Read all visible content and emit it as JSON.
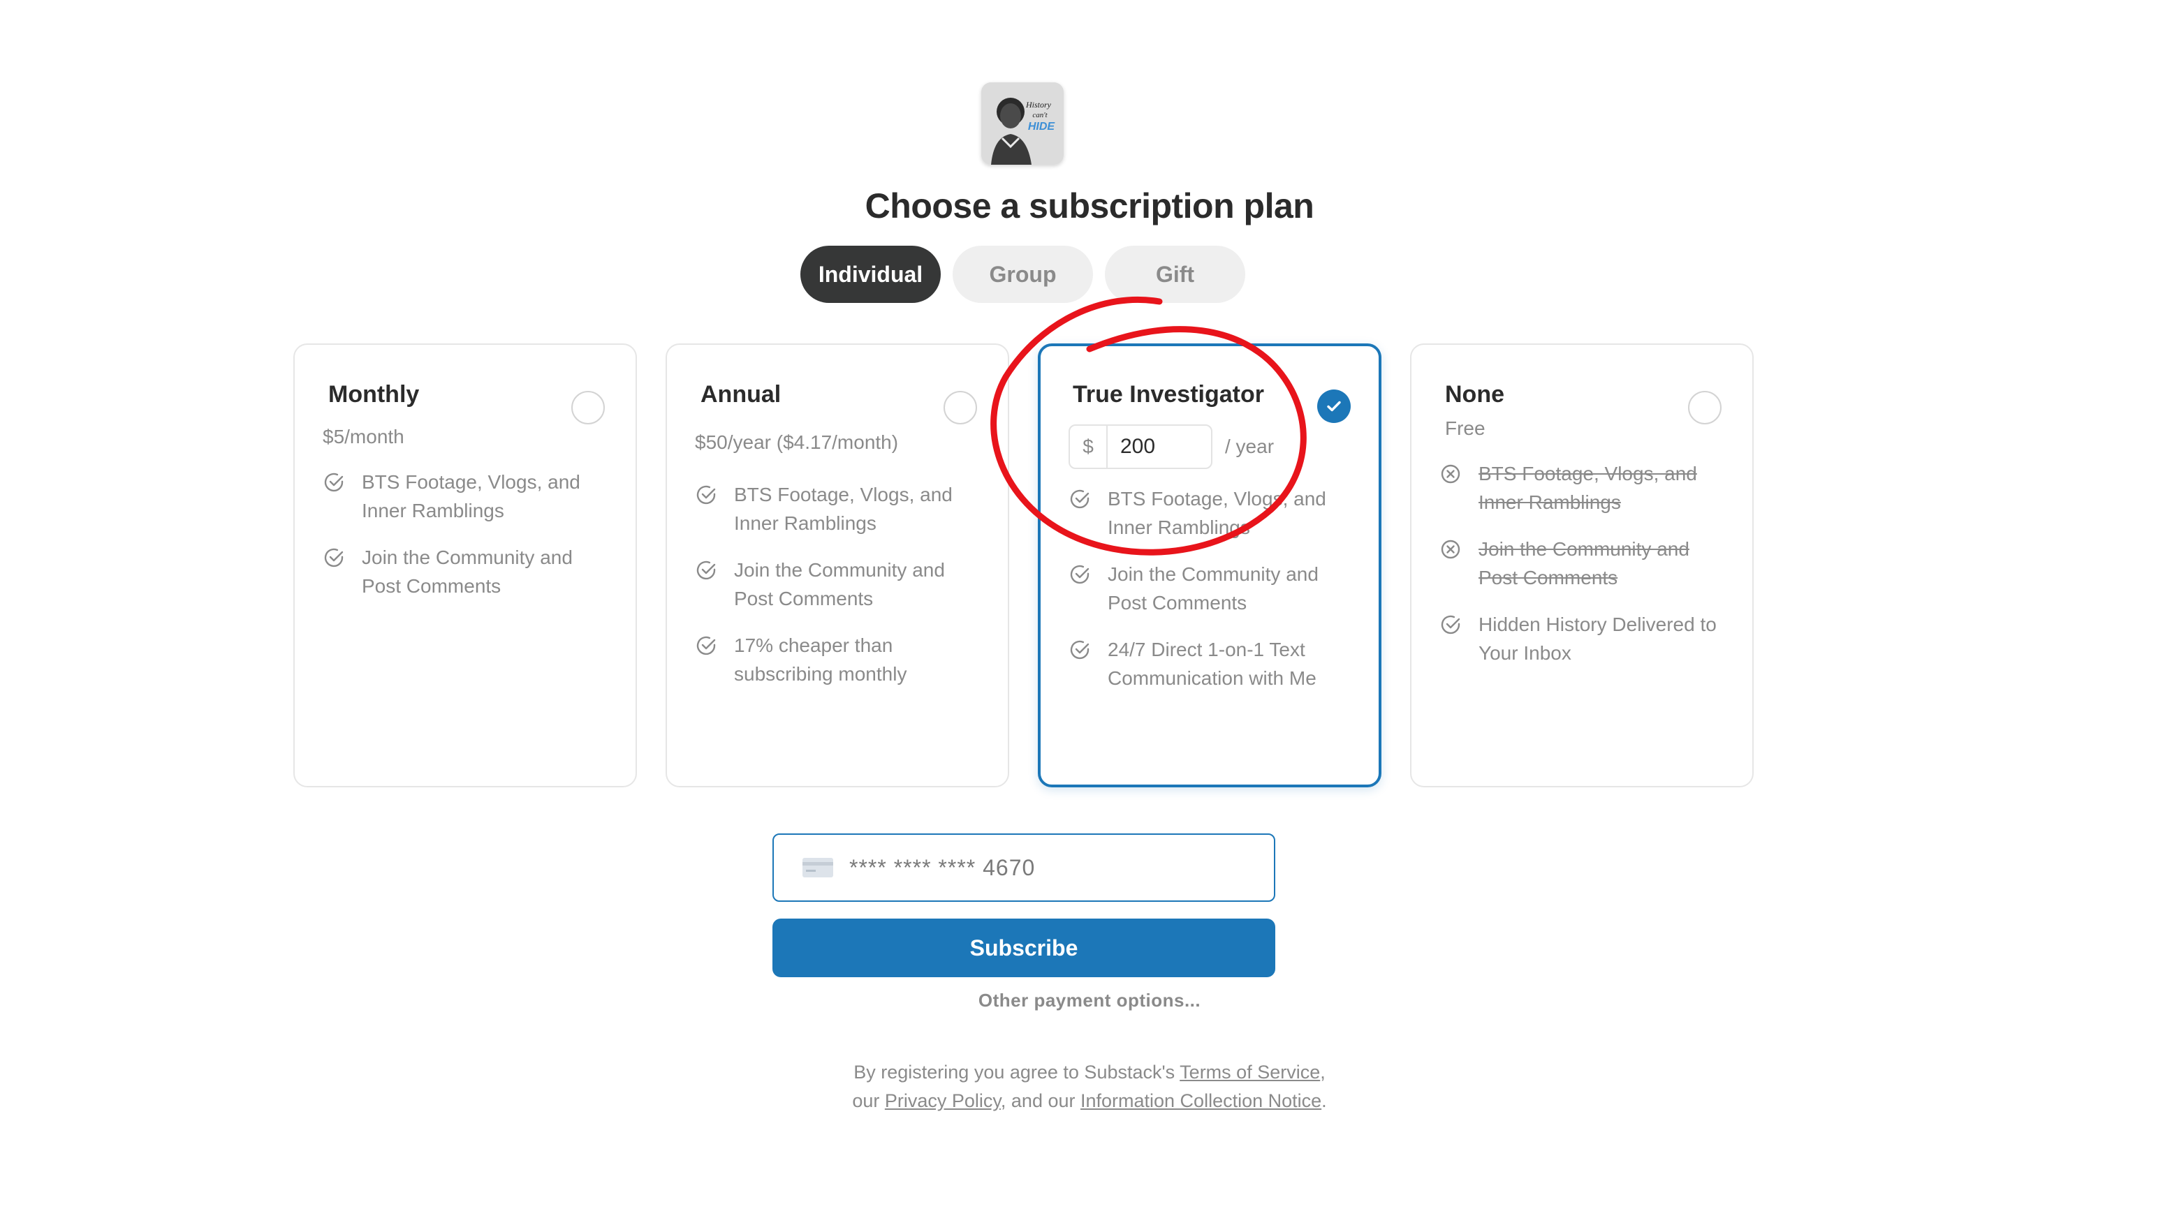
{
  "header": {
    "logo_icon": "publication-logo",
    "logo_text": [
      "History",
      "can't",
      "HIDE"
    ],
    "title": "Choose a subscription plan"
  },
  "tabs": [
    {
      "label": "Individual",
      "active": true
    },
    {
      "label": "Group",
      "active": false
    },
    {
      "label": "Gift",
      "active": false
    }
  ],
  "plans": [
    {
      "title": "Monthly",
      "price": "$5/month",
      "selected": false,
      "features": [
        {
          "text": "BTS Footage, Vlogs, and Inner Ramblings",
          "included": true
        },
        {
          "text": "Join the Community and Post Comments",
          "included": true
        }
      ]
    },
    {
      "title": "Annual",
      "price": "$50/year ($4.17/month)",
      "selected": false,
      "features": [
        {
          "text": "BTS Footage, Vlogs, and Inner Ramblings",
          "included": true
        },
        {
          "text": "Join the Community and Post Comments",
          "included": true
        },
        {
          "text": "17% cheaper than subscribing monthly",
          "included": true
        }
      ]
    },
    {
      "title": "True Investigator",
      "currency": "$",
      "amount": "200",
      "per": "/ year",
      "selected": true,
      "features": [
        {
          "text": "BTS Footage, Vlogs, and Inner Ramblings",
          "included": true
        },
        {
          "text": "Join the Community and Post Comments",
          "included": true
        },
        {
          "text": "24/7 Direct 1-on-1 Text Communication with Me",
          "included": true
        }
      ]
    },
    {
      "title": "None",
      "price": "Free",
      "selected": false,
      "features": [
        {
          "text": "BTS Footage, Vlogs, and Inner Ramblings",
          "included": false
        },
        {
          "text": "Join the Community and Post Comments",
          "included": false
        },
        {
          "text": "Hidden History Delivered to Your Inbox",
          "included": true
        }
      ]
    }
  ],
  "payment": {
    "card_icon": "credit-card-icon",
    "card_masked": "**** **** **** 4670",
    "subscribe_label": "Subscribe",
    "other_options": "Other payment options..."
  },
  "legal": {
    "prefix": "By registering you agree to Substack's ",
    "terms": "Terms of Service",
    "comma": ",",
    "line2_prefix": "our ",
    "privacy": "Privacy Policy",
    "middle": ", and our ",
    "notice": "Information Collection Notice",
    "end": "."
  },
  "colors": {
    "accent": "#1c77b8",
    "dark": "#363737",
    "muted": "#8a8a8a",
    "annotation": "#e8141b"
  }
}
